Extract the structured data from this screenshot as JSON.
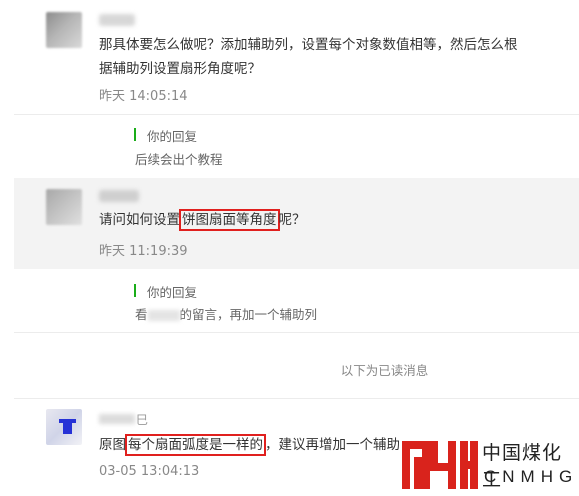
{
  "comments": [
    {
      "text_line1": "那具体要怎么做呢？添加辅助列，设置每个对象数值相等，然后怎么根",
      "text_line2": "据辅助列设置扇形角度呢？",
      "time": "昨天 14:05:14",
      "reply_label": "你的回复",
      "reply_text": "后续会出个教程"
    },
    {
      "text_before": "请问如何设置",
      "text_highlight": "饼图扇面等角度",
      "text_after": "呢？",
      "time": "昨天 11:19:39",
      "reply_label": "你的回复",
      "reply_text_before": "看",
      "reply_text_after": "的留言，再加一个辅助列"
    },
    {
      "name_suffix": "巳",
      "text_before": "原图",
      "text_highlight": "每个扇面弧度是一样的",
      "text_after": "，建议再增加一个辅助",
      "time": "03-05 13:04:13"
    }
  ],
  "read_notice": "以下为已读消息",
  "logo": {
    "cn": "中国煤化工",
    "en": "CNMHG",
    "color": "#d9231c"
  },
  "colors": {
    "highlight": "#e0201e",
    "reply_bar": "#1aad19",
    "avatar_mark": "#2632d6"
  }
}
